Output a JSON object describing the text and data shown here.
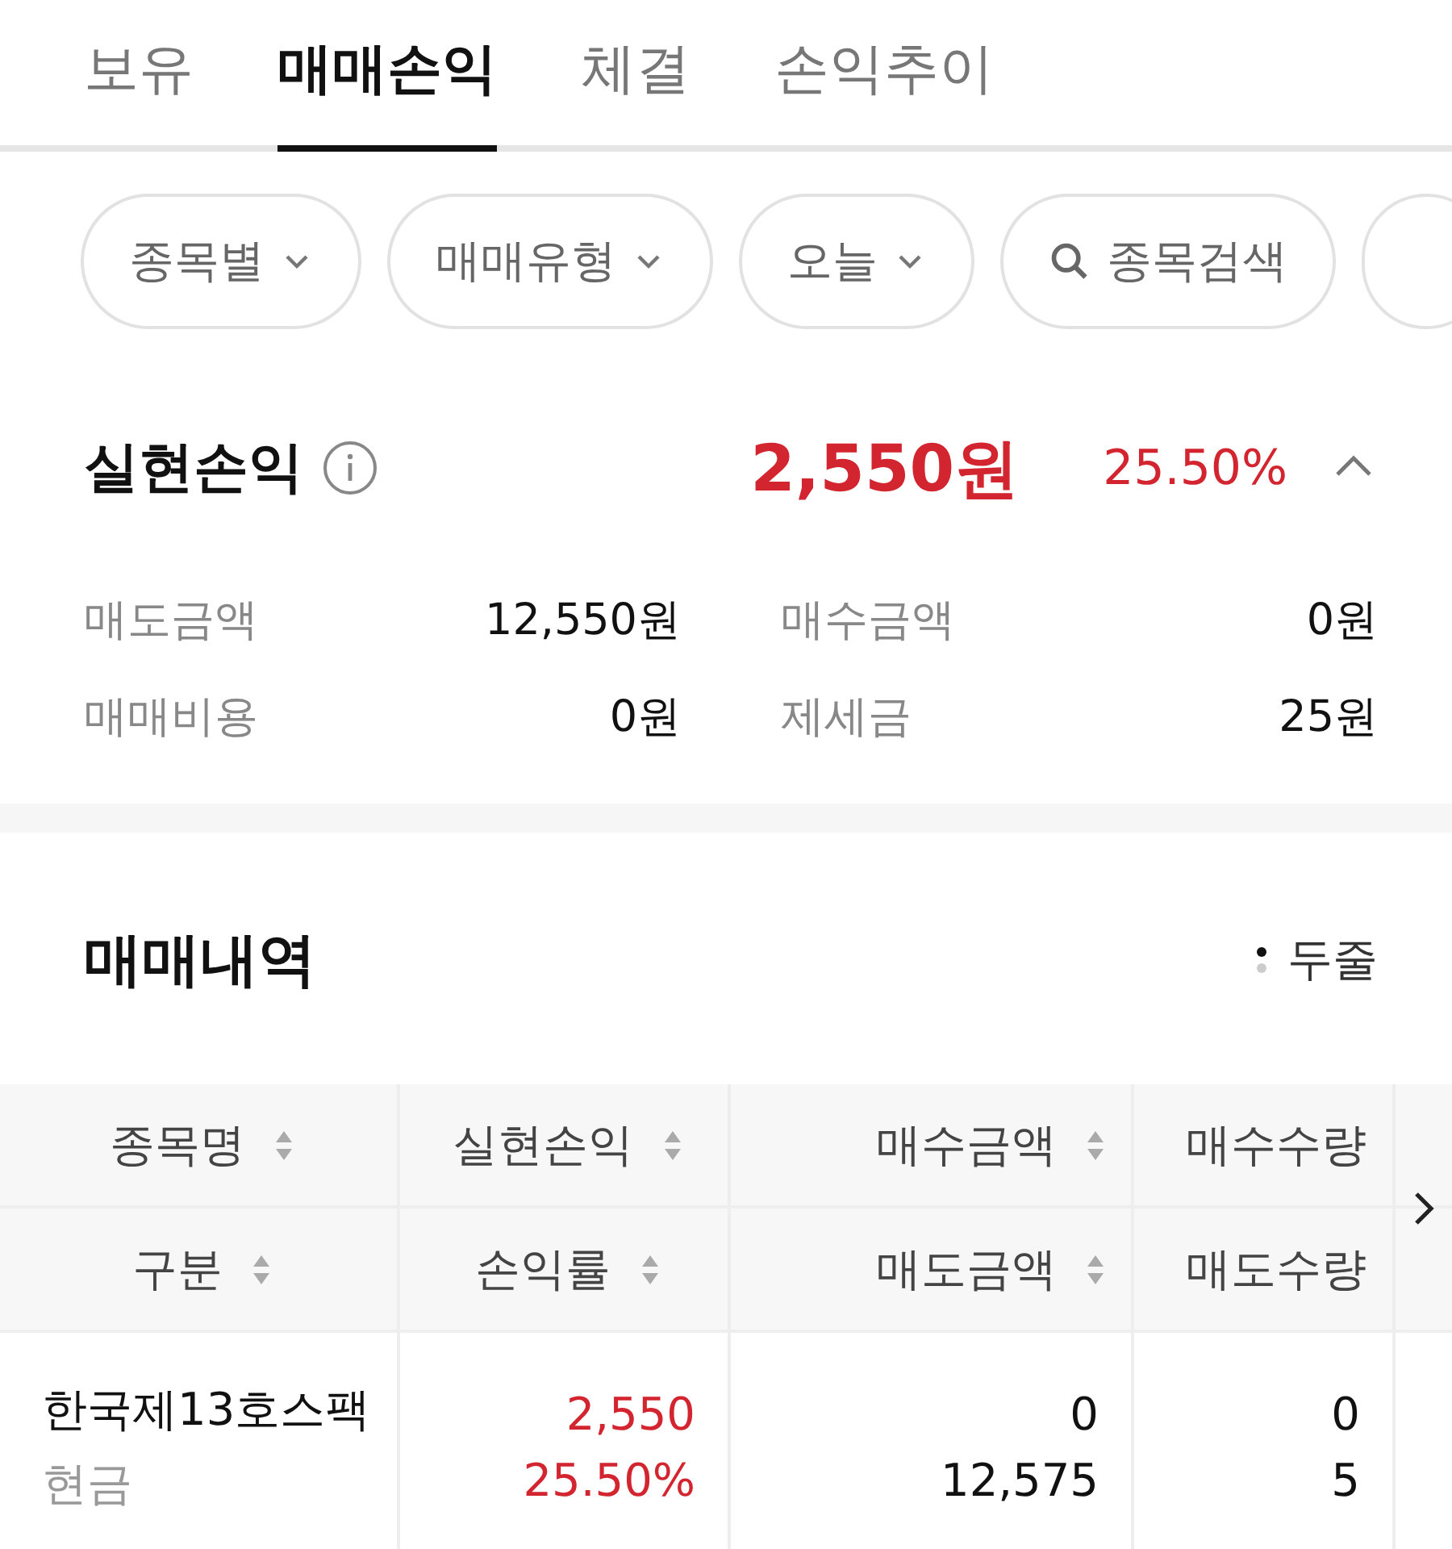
{
  "tabs": [
    {
      "label": "보유",
      "selected": false
    },
    {
      "label": "매매손익",
      "selected": true
    },
    {
      "label": "체결",
      "selected": false
    },
    {
      "label": "손익추이",
      "selected": false
    }
  ],
  "filters": [
    {
      "kind": "dropdown",
      "label": "종목별"
    },
    {
      "kind": "dropdown",
      "label": "매매유형"
    },
    {
      "kind": "dropdown",
      "label": "오늘"
    },
    {
      "kind": "search",
      "label": "종목검색"
    },
    {
      "kind": "blank"
    }
  ],
  "summary": {
    "title": "실현손익",
    "amount": "2,550원",
    "rate": "25.50%",
    "gain": true,
    "expanded": true,
    "details": [
      {
        "label": "매도금액",
        "value": "12,550원"
      },
      {
        "label": "매수금액",
        "value": "0원"
      },
      {
        "label": "매매비용",
        "value": "0원"
      },
      {
        "label": "제세금",
        "value": "25원"
      }
    ]
  },
  "history": {
    "title": "매매내역",
    "toggle": "두줄",
    "header_rows": [
      [
        "종목명",
        "실현손익",
        "매수금액",
        "매수수량"
      ],
      [
        "구분",
        "손익률",
        "매도금액",
        "매도수량"
      ]
    ],
    "rows": [
      {
        "name": "한국제13호스팩",
        "type": "현금",
        "pnl": "2,550",
        "rate": "25.50%",
        "gain": true,
        "buy_amount": "0",
        "sell_amount": "12,575",
        "buy_qty": "0",
        "sell_qty": "5"
      }
    ]
  }
}
